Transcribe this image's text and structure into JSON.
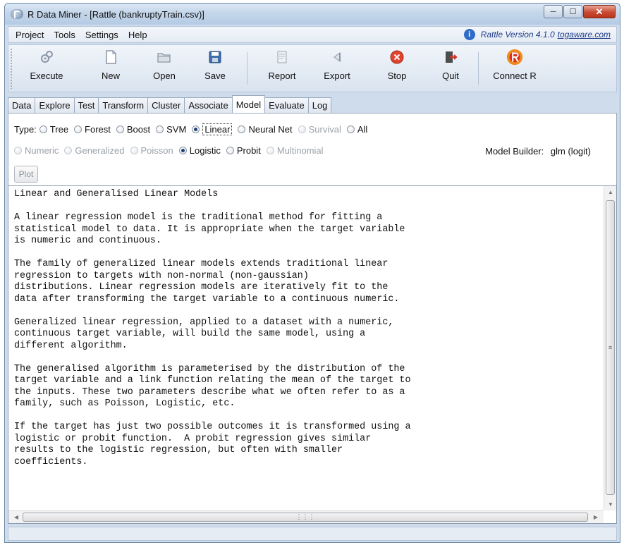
{
  "window": {
    "title": "R Data Miner - [Rattle (bankruptyTrain.csv)]"
  },
  "menu": {
    "items": [
      "Project",
      "Tools",
      "Settings",
      "Help"
    ]
  },
  "version": {
    "text": "Rattle Version 4.1.0",
    "link": "togaware.com"
  },
  "toolbar": {
    "buttons": [
      {
        "label": "Execute",
        "icon": "execute-icon"
      },
      {
        "label": "New",
        "icon": "new-document-icon"
      },
      {
        "label": "Open",
        "icon": "folder-open-icon"
      },
      {
        "label": "Save",
        "icon": "save-disk-icon"
      },
      {
        "label": "Report",
        "icon": "report-icon"
      },
      {
        "label": "Export",
        "icon": "export-icon"
      },
      {
        "label": "Stop",
        "icon": "stop-icon"
      },
      {
        "label": "Quit",
        "icon": "quit-icon"
      },
      {
        "label": "Connect R",
        "icon": "r-logo-icon"
      }
    ]
  },
  "tabs": [
    "Data",
    "Explore",
    "Test",
    "Transform",
    "Cluster",
    "Associate",
    "Model",
    "Evaluate",
    "Log"
  ],
  "active_tab": "Model",
  "model": {
    "type_label": "Type:",
    "types": [
      "Tree",
      "Forest",
      "Boost",
      "SVM",
      "Linear",
      "Neural Net",
      "Survival",
      "All"
    ],
    "selected_type": "Linear",
    "families": [
      "Numeric",
      "Generalized",
      "Poisson",
      "Logistic",
      "Probit",
      "Multinomial"
    ],
    "selected_family": "Logistic",
    "builder_label": "Model Builder:",
    "builder_value": "glm (logit)",
    "plot_label": "Plot"
  },
  "text_output": [
    "Linear and Generalised Linear Models",
    "",
    "A linear regression model is the traditional method for fitting a",
    "statistical model to data. It is appropriate when the target variable",
    "is numeric and continuous.",
    "",
    "The family of generalized linear models extends traditional linear",
    "regression to targets with non-normal (non-gaussian)",
    "distributions. Linear regression models are iteratively fit to the",
    "data after transforming the target variable to a continuous numeric.",
    "",
    "Generalized linear regression, applied to a dataset with a numeric,",
    "continuous target variable, will build the same model, using a",
    "different algorithm.",
    "",
    "The generalised algorithm is parameterised by the distribution of the",
    "target variable and a link function relating the mean of the target to",
    "the inputs. These two parameters describe what we often refer to as a",
    "family, such as Poisson, Logistic, etc.",
    "",
    "If the target has just two possible outcomes it is transformed using a",
    "logistic or probit function.  A probit regression gives similar",
    "results to the logistic regression, but often with smaller",
    "coefficients."
  ]
}
